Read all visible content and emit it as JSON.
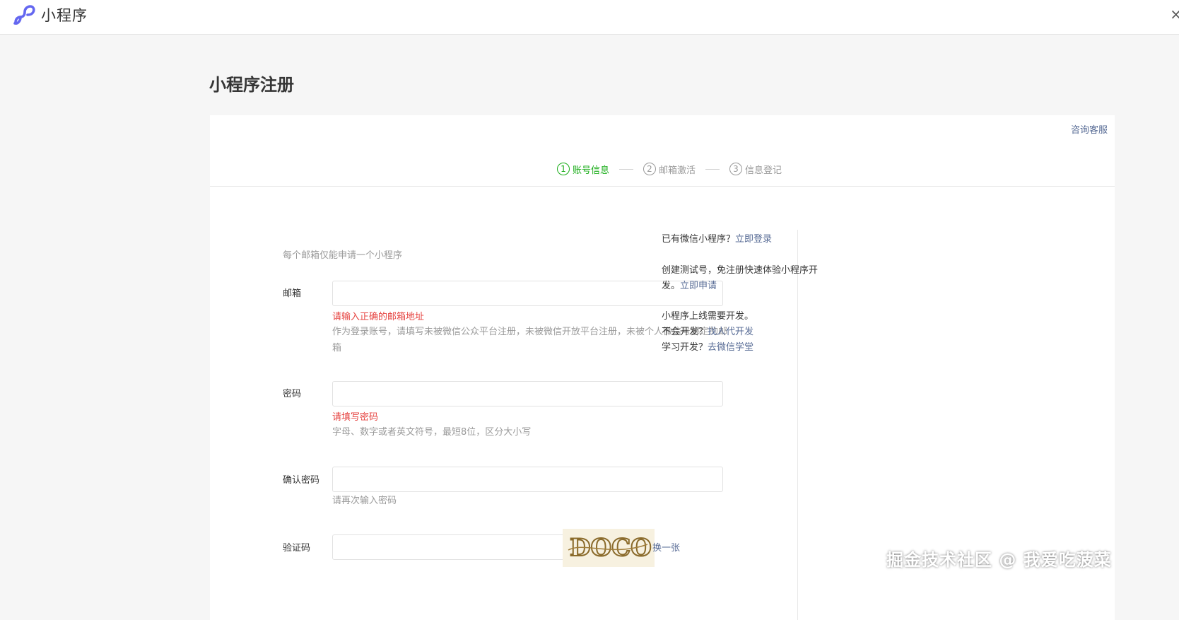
{
  "header": {
    "logo_text": "小程序",
    "close_label": "×",
    "brand_color": "#6467f0"
  },
  "page_title": "小程序注册",
  "consult_link": "咨询客服",
  "steps": [
    {
      "num": "1",
      "label": "账号信息",
      "active": true
    },
    {
      "num": "2",
      "label": "邮箱激活",
      "active": false
    },
    {
      "num": "3",
      "label": "信息登记",
      "active": false
    }
  ],
  "form": {
    "notice": "每个邮箱仅能申请一个小程序",
    "email": {
      "label": "邮箱",
      "value": "",
      "error": "请输入正确的邮箱地址",
      "hint": "作为登录账号，请填写未被微信公众平台注册，未被微信开放平台注册，未被个人微信号绑定的邮箱"
    },
    "password": {
      "label": "密码",
      "value": "",
      "error": "请填写密码",
      "hint": "字母、数字或者英文符号，最短8位，区分大小写"
    },
    "confirm": {
      "label": "确认密码",
      "value": "",
      "hint": "请再次输入密码"
    },
    "captcha": {
      "label": "验证码",
      "value": "",
      "image_text": "DOCO",
      "refresh_label": "换一张"
    }
  },
  "side": {
    "login_text": "已有微信小程序？",
    "login_link": "立即登录",
    "test_text": "创建测试号，免注册快速体验小程序开发。",
    "test_link": "立即申请",
    "dev_line": "小程序上线需要开发。",
    "outsource_text": "不会开发？",
    "outsource_link": "找人代开发",
    "learn_text": "学习开发？",
    "learn_link": "去微信学堂"
  },
  "watermark": "掘金技术社区 @ 我爱吃菠菜",
  "colors": {
    "active_step": "#1aad19",
    "error": "#e64340",
    "link": "#576b95"
  }
}
